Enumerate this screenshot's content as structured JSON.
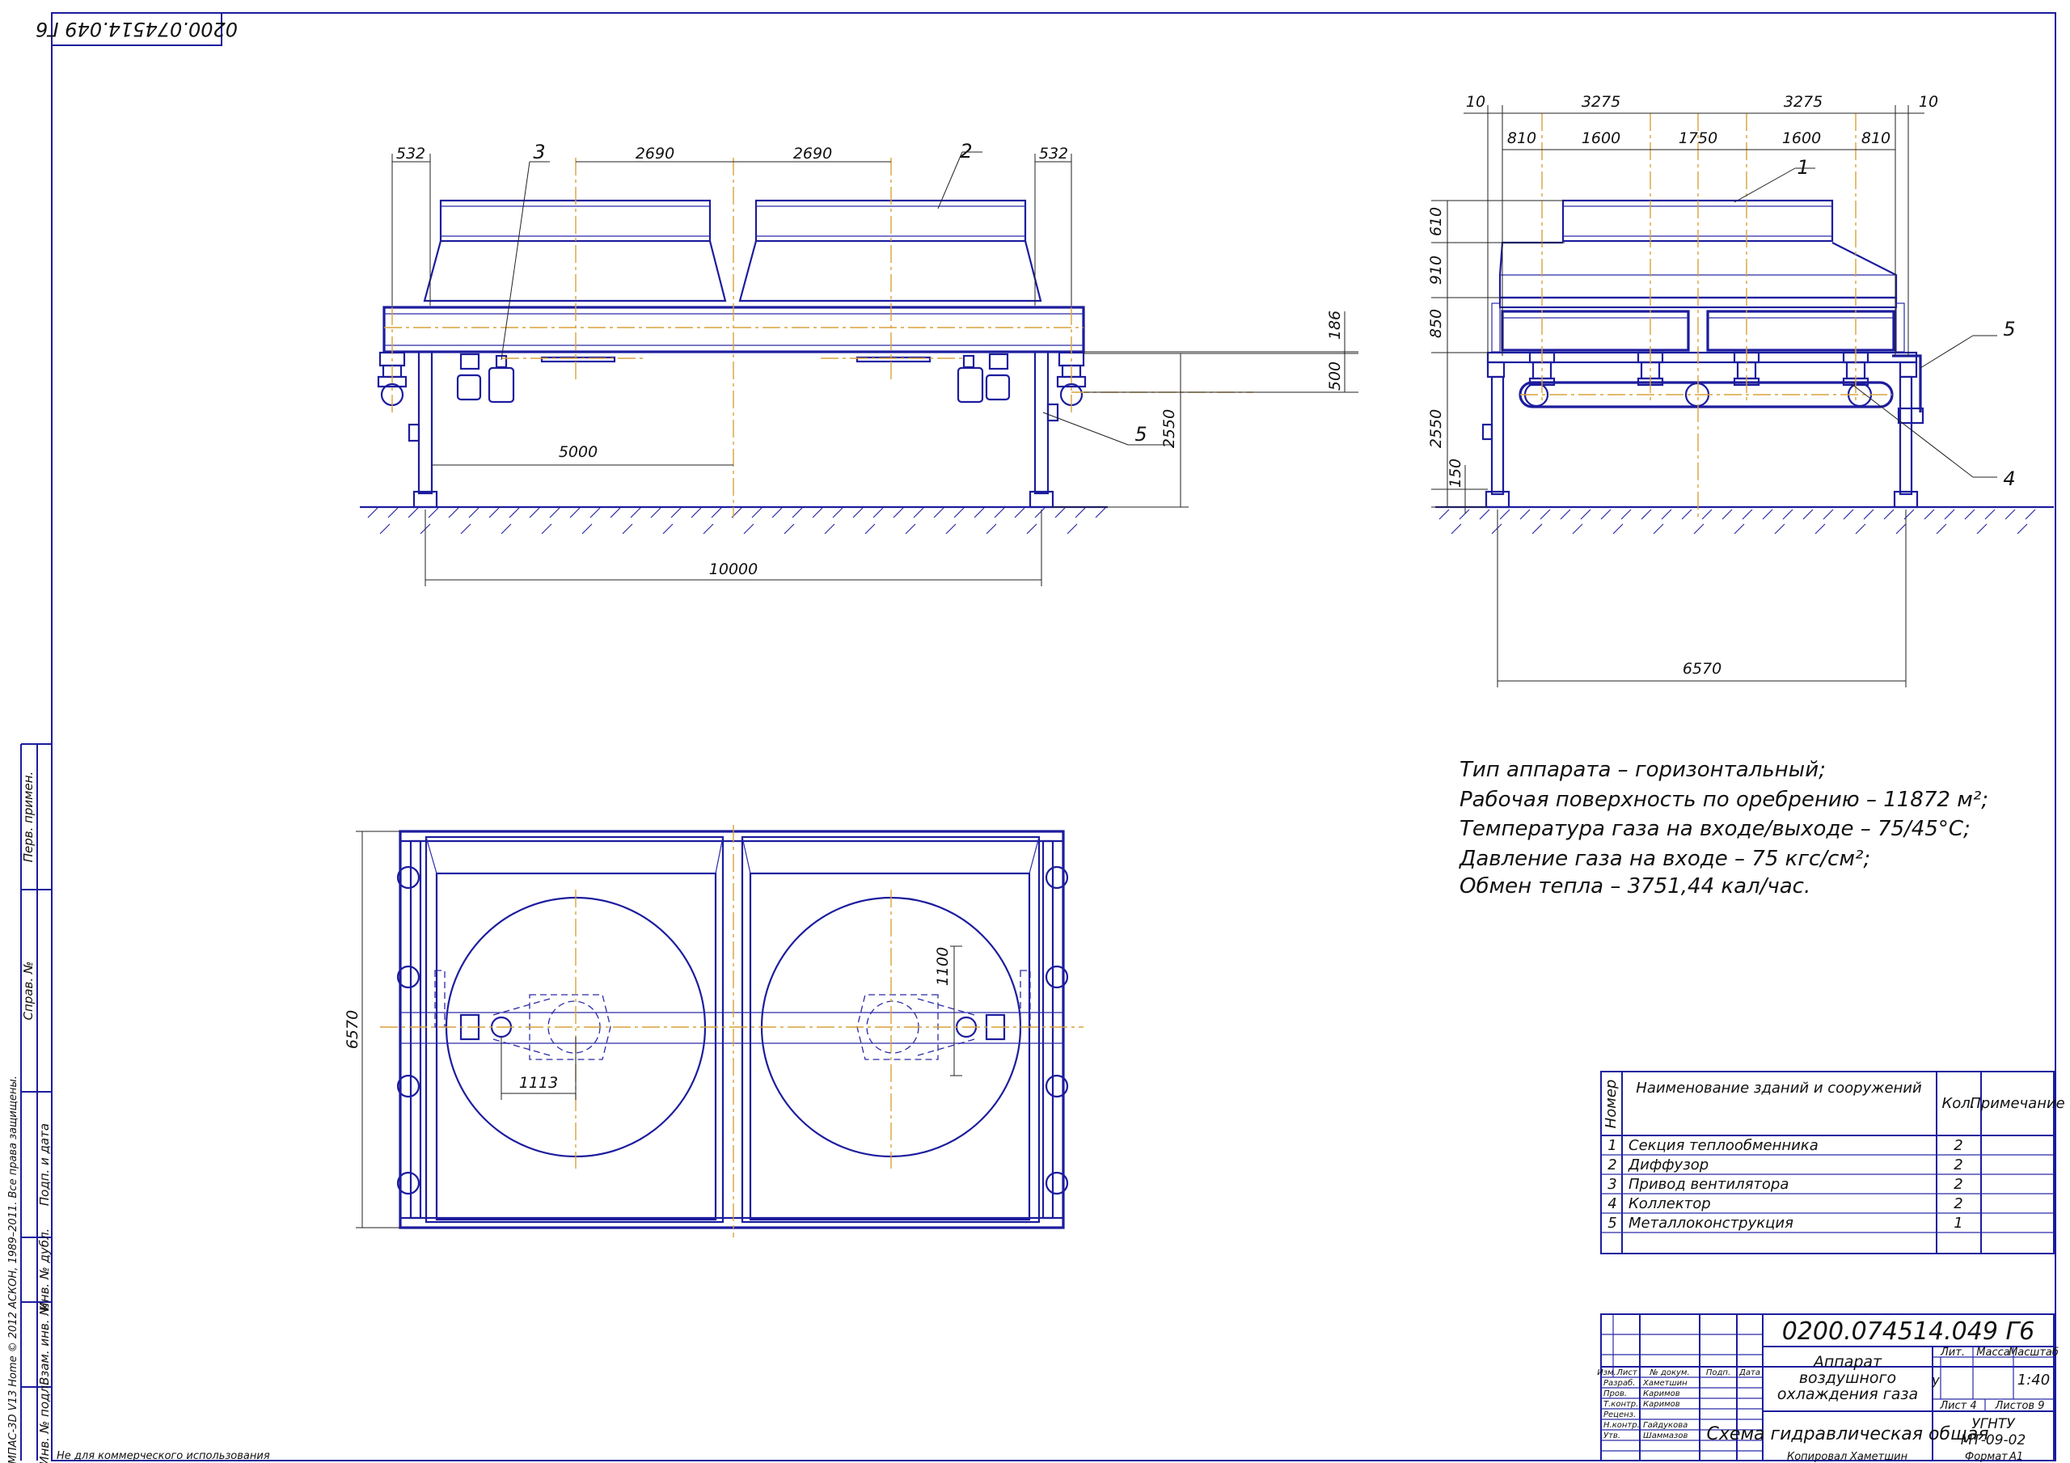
{
  "doc_code": "0200.074514.049 Г6",
  "doc_code_rotated": "0200.074514.049 Г6",
  "front_view": {
    "dims": {
      "d532_left": "532",
      "d2690_a": "2690",
      "d2690_b": "2690",
      "d532_right": "532",
      "d186": "186",
      "d500": "500",
      "d2550": "2550",
      "d5000": "5000",
      "d10000": "10000"
    },
    "leaders": {
      "l3": "3",
      "l2": "2",
      "l5": "5"
    }
  },
  "side_view": {
    "dims": {
      "d10_left": "10",
      "d3275_a": "3275",
      "d3275_b": "3275",
      "d10_right": "10",
      "d810_a": "810",
      "d1600_a": "1600",
      "d1750": "1750",
      "d1600_b": "1600",
      "d810_b": "810",
      "d610": "610",
      "d910": "910",
      "d850": "850",
      "d2550": "2550",
      "d150": "150",
      "d6570": "6570"
    },
    "leaders": {
      "l1": "1",
      "l5": "5",
      "l4": "4"
    }
  },
  "plan_view": {
    "dims": {
      "d6570": "6570",
      "d1100": "1100",
      "d1113": "1113"
    }
  },
  "notes": {
    "line1": "Тип аппарата – горизонтальный;",
    "line2": "Рабочая поверхность по оребрению – 11872 м²;",
    "line3": "Температура газа на входе/выходе – 75/45°С;",
    "line4": "Давление газа на входе – 75 кгс/см²;",
    "line5": "Обмен тепла – 3751,44 кал/час."
  },
  "spec_table": {
    "headers": {
      "number": "Номер",
      "name": "Наименование зданий и сооружений",
      "qty": "Кол.",
      "remark": "Примечание"
    },
    "rows": [
      {
        "n": "1",
        "name": "Секция теплообменника",
        "qty": "2"
      },
      {
        "n": "2",
        "name": "Диффузор",
        "qty": "2"
      },
      {
        "n": "3",
        "name": "Привод вентилятора",
        "qty": "2"
      },
      {
        "n": "4",
        "name": "Коллектор",
        "qty": "2"
      },
      {
        "n": "5",
        "name": "Металлоконструкция",
        "qty": "1"
      }
    ]
  },
  "title_block": {
    "code": "0200.074514.049 Г6",
    "title": "Аппарат воздушного охлаждения газа",
    "subtitle": "Схема гидравлическая общая",
    "lit_label": "Лит.",
    "mass_label": "Масса",
    "scale_label": "Масштаб",
    "lit_value": "у",
    "scale_value": "1:40",
    "sheet": "Лист 4",
    "sheets": "Листов 9",
    "org1": "УГНТУ",
    "org2": "МТ-09-02",
    "head_izm": "Изм.",
    "head_list": "Лист",
    "head_doc": "№ докум.",
    "head_sign": "Подп.",
    "head_date": "Дата",
    "roles": [
      "Разраб.",
      "Пров.",
      "Т.контр.",
      "Реценз.",
      "Н.контр.",
      "Утв."
    ],
    "names": [
      "Хаметшин",
      "Каримов",
      "Каримов",
      "",
      "Гайдукова",
      "Шаммазов"
    ],
    "copied": "Копировал",
    "copied_name": "Хаметшин",
    "format": "Формат",
    "format_value": "А1"
  },
  "side_stamp": {
    "perv_primen": "Перв. примен.",
    "sprav": "Справ. №",
    "podp_data1": "Подп. и дата",
    "inv_dubl": "Инв. № дубл.",
    "vzam_inv": "Взам. инв. №",
    "podp_data2": "Подп. и дата",
    "inv_podl": "Инв. № подл."
  },
  "software_note": "КОМПАС-3D V13 Home © 2012 АСКОН, 1989–2011. Все права защищены.",
  "footer_note": "Не для коммерческого использования"
}
